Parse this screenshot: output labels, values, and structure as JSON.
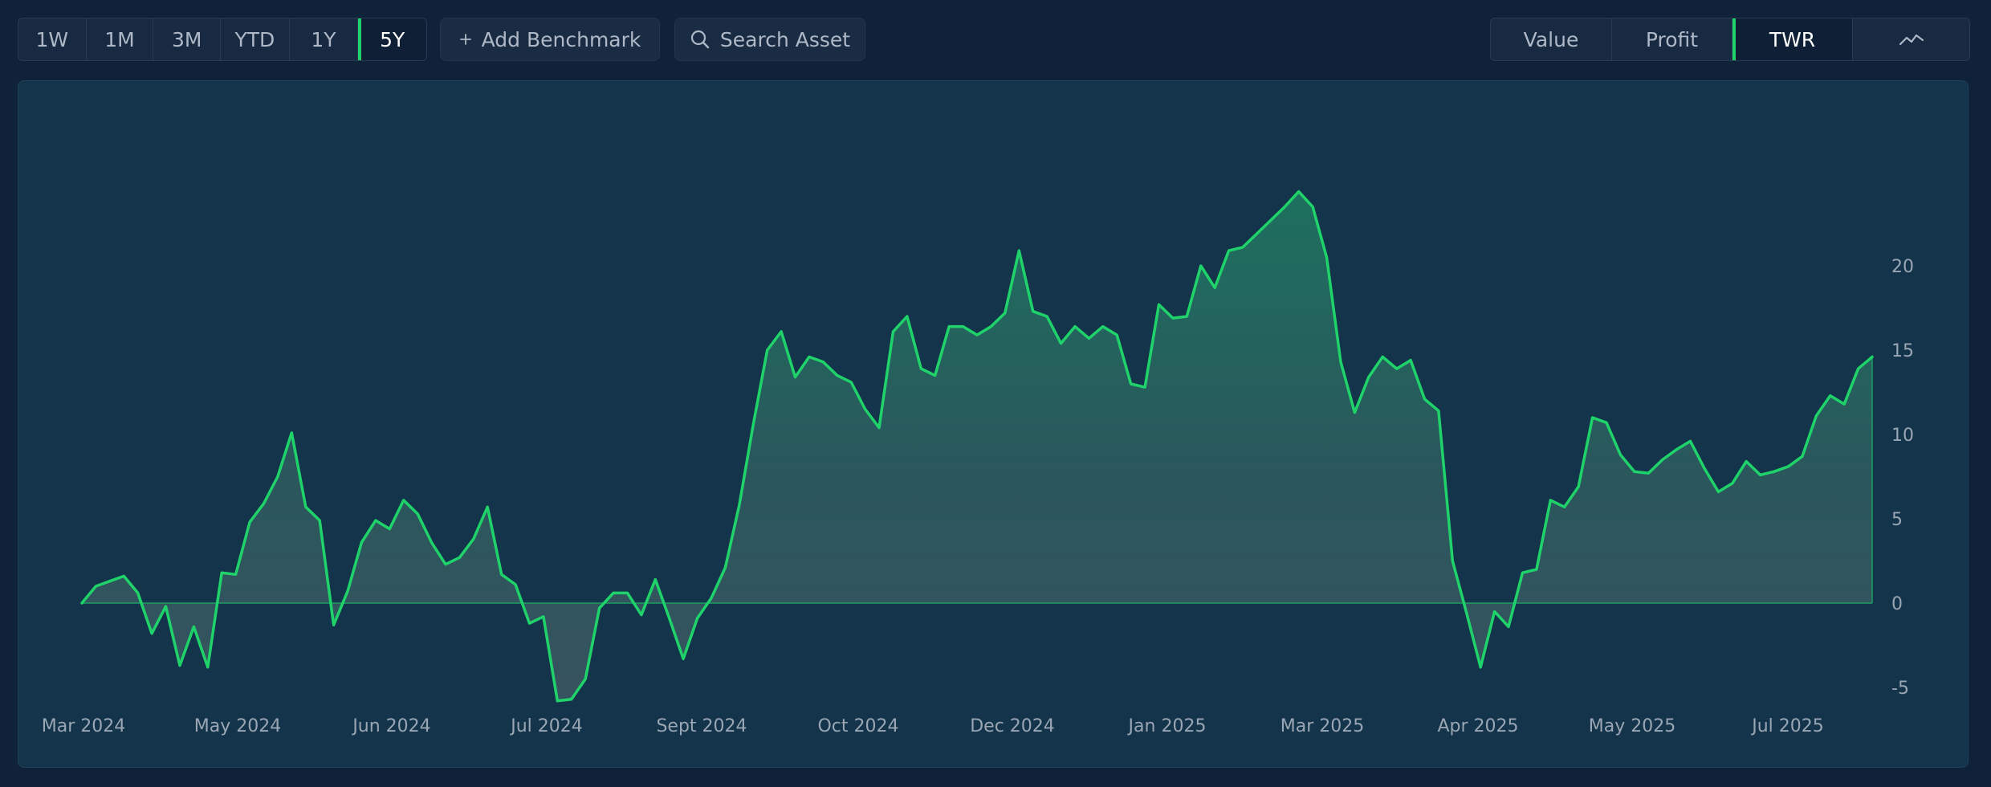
{
  "toolbar": {
    "ranges": [
      "1W",
      "1M",
      "3M",
      "YTD",
      "1Y",
      "5Y"
    ],
    "active_range": "5Y",
    "add_benchmark_label": "Add Benchmark",
    "search_asset_label": "Search Asset",
    "metrics": [
      "Value",
      "Profit",
      "TWR"
    ],
    "active_metric": "TWR"
  },
  "colors": {
    "line": "#1fd36a",
    "active_indicator": "#1fd36a",
    "background": "#10213a",
    "panel": "#13344a"
  },
  "icons": {
    "add": "plus-icon",
    "search": "search-icon",
    "chart_toggle": "line-chart-icon"
  },
  "chart_data": {
    "type": "area",
    "title": "",
    "xlabel": "",
    "ylabel": "",
    "ylim": [
      -6,
      24
    ],
    "yticks": [
      -5,
      0,
      5,
      10,
      15,
      20
    ],
    "y_axis_position": "right",
    "grid": false,
    "x_tick_labels": [
      "Mar 2024",
      "May 2024",
      "Jun 2024",
      "Jul 2024",
      "Sept 2024",
      "Oct 2024",
      "Dec 2024",
      "Jan 2025",
      "Mar 2025",
      "Apr 2025",
      "May 2025",
      "Jul 2025"
    ],
    "series": [
      {
        "values": [
          0,
          1.0,
          1.3,
          1.6,
          0.6,
          -1.8,
          -0.2,
          -3.7,
          -1.4,
          -3.8,
          1.8,
          1.7,
          4.8,
          5.9,
          7.5,
          10.1,
          5.7,
          4.9,
          -1.3,
          0.7,
          3.6,
          4.9,
          4.4,
          6.1,
          5.3,
          3.6,
          2.3,
          2.7,
          3.8,
          5.7,
          1.7,
          1.1,
          -1.2,
          -0.8,
          -5.8,
          -5.7,
          -4.5,
          -0.3,
          0.6,
          0.6,
          -0.7,
          1.4,
          -0.9,
          -3.3,
          -0.9,
          0.3,
          2.1,
          5.8,
          10.6,
          15.0,
          16.1,
          13.4,
          14.6,
          14.3,
          13.5,
          13.1,
          11.5,
          10.4,
          16.1,
          17.0,
          13.9,
          13.5,
          16.4,
          16.4,
          15.9,
          16.4,
          17.2,
          20.9,
          17.3,
          17.0,
          15.4,
          16.4,
          15.7,
          16.4,
          15.9,
          13.0,
          12.8,
          17.7,
          16.9,
          17.0,
          20.0,
          18.7,
          20.9,
          21.1,
          21.9,
          22.7,
          23.5,
          24.4,
          23.5,
          20.5,
          14.3,
          11.3,
          13.4,
          14.6,
          13.9,
          14.4,
          12.1,
          11.4,
          2.5,
          -0.6,
          -3.8,
          -0.5,
          -1.4,
          1.8,
          2.0,
          6.1,
          5.7,
          6.9,
          11.0,
          10.7,
          8.8,
          7.8,
          7.7,
          8.5,
          9.1,
          9.6,
          8.0,
          6.6,
          7.1,
          8.4,
          7.6,
          7.8,
          8.1,
          8.7,
          11.1,
          12.3,
          11.8,
          13.9,
          14.6
        ]
      }
    ]
  }
}
